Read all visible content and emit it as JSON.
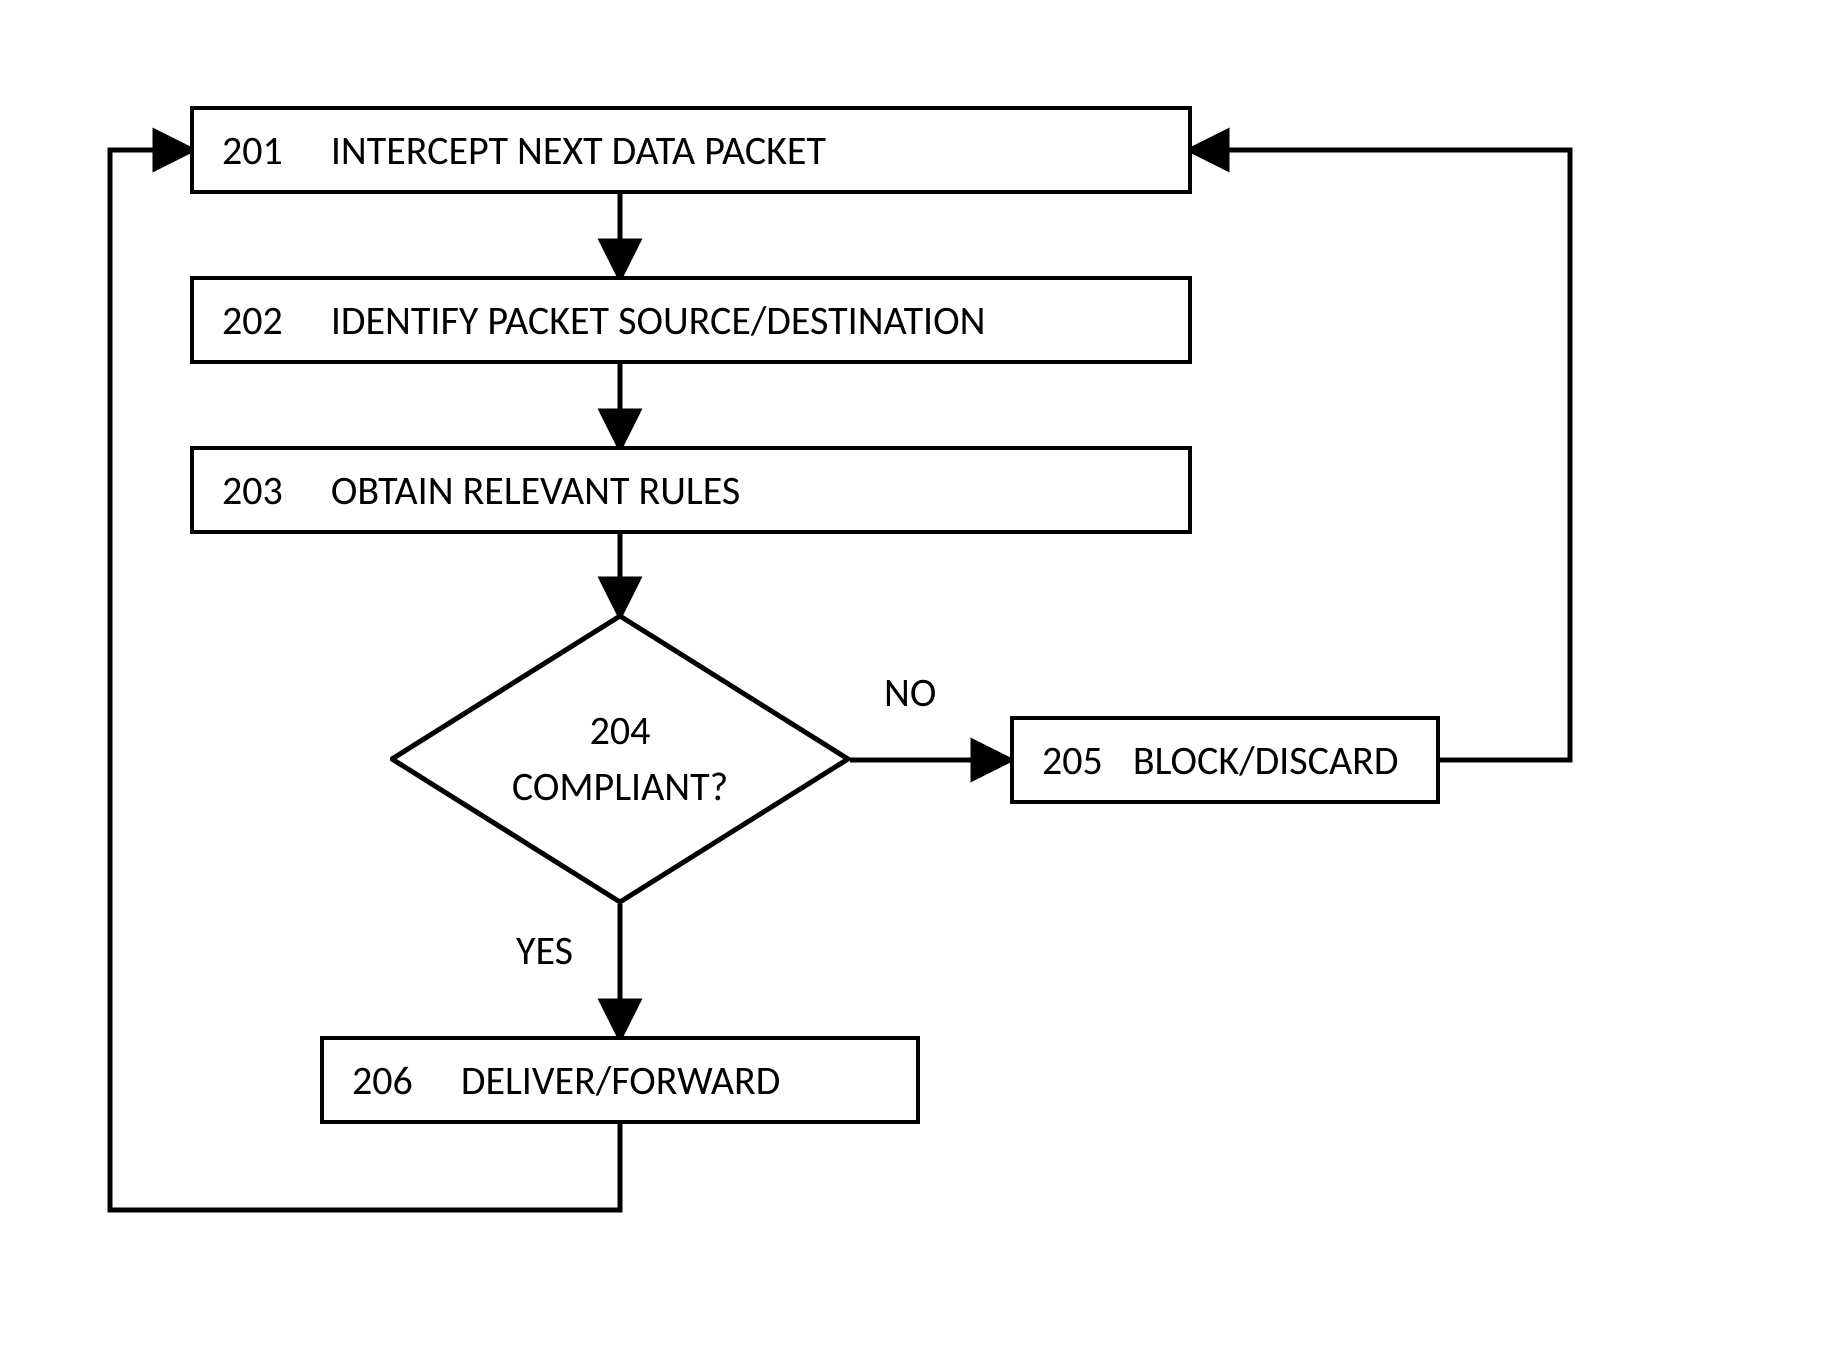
{
  "flowchart": {
    "nodes": {
      "step1": {
        "num": "201",
        "label": "INTERCEPT NEXT DATA PACKET"
      },
      "step2": {
        "num": "202",
        "label": "IDENTIFY PACKET SOURCE/DESTINATION"
      },
      "step3": {
        "num": "203",
        "label": "OBTAIN RELEVANT RULES"
      },
      "decision": {
        "num": "204",
        "label": "COMPLIANT?"
      },
      "step5": {
        "num": "205",
        "label": "BLOCK/DISCARD"
      },
      "step6": {
        "num": "206",
        "label": "DELIVER/FORWARD"
      }
    },
    "edges": {
      "no": "NO",
      "yes": "YES"
    }
  }
}
